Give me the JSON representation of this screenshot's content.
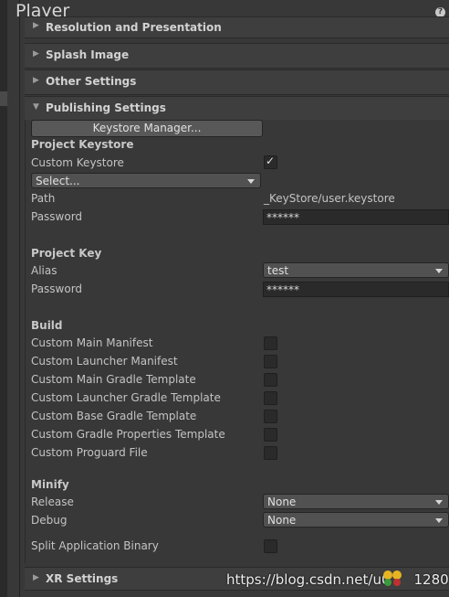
{
  "window": {
    "title": "Player",
    "help_icon": "?"
  },
  "foldouts": {
    "resolution": "Resolution and Presentation",
    "splash": "Splash Image",
    "other": "Other Settings",
    "publishing": "Publishing Settings",
    "xr": "XR Settings"
  },
  "publishing": {
    "keystore_manager_button": "Keystore Manager...",
    "project_keystore": {
      "header": "Project Keystore",
      "custom_keystore_label": "Custom Keystore",
      "custom_keystore_checked": true,
      "select_value": "Select...",
      "path_label": "Path",
      "path_value": "_KeyStore/user.keystore",
      "password_label": "Password",
      "password_value": "******"
    },
    "project_key": {
      "header": "Project Key",
      "alias_label": "Alias",
      "alias_value": "test",
      "password_label": "Password",
      "password_value": "******"
    },
    "build": {
      "header": "Build",
      "items": [
        {
          "label": "Custom Main Manifest",
          "checked": false
        },
        {
          "label": "Custom Launcher Manifest",
          "checked": false
        },
        {
          "label": "Custom Main Gradle Template",
          "checked": false
        },
        {
          "label": "Custom Launcher Gradle Template",
          "checked": false
        },
        {
          "label": "Custom Base Gradle Template",
          "checked": false
        },
        {
          "label": "Custom Gradle Properties Template",
          "checked": false
        },
        {
          "label": "Custom Proguard File",
          "checked": false
        }
      ]
    },
    "minify": {
      "header": "Minify",
      "release_label": "Release",
      "release_value": "None",
      "debug_label": "Debug",
      "debug_value": "None"
    },
    "split_binary_label": "Split Application Binary",
    "split_binary_checked": false
  },
  "watermark": "https://blog.csdn.net/u0",
  "watermark_tail": "1280"
}
